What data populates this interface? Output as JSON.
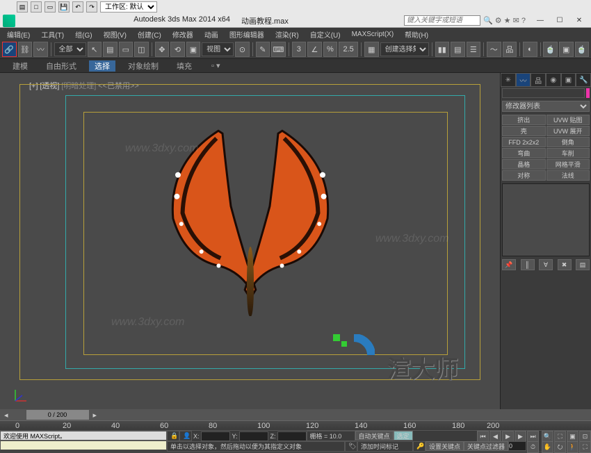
{
  "app": {
    "title": "Autodesk 3ds Max  2014 x64",
    "file": "动画教程.max",
    "search_placeholder": "键入关键字或短语"
  },
  "workspace": {
    "label": "工作区: 默认"
  },
  "menu": [
    "编辑(E)",
    "工具(T)",
    "组(G)",
    "视图(V)",
    "创建(C)",
    "修改器",
    "动画",
    "图形编辑器",
    "渲染(R)",
    "自定义(U)",
    "MAXScript(X)",
    "帮助(H)"
  ],
  "toolbar": {
    "all": "全部",
    "view": "视图",
    "spinner": "2.5",
    "selset": "创建选择集"
  },
  "ribbon": {
    "tabs": [
      "建模",
      "自由形式",
      "选择",
      "对象绘制",
      "填充"
    ],
    "selected": 2
  },
  "viewport": {
    "bracket": "[+]",
    "mode": "[透视]",
    "shade": "[明暗处理]",
    "note": "<<已禁用>>"
  },
  "cmd": {
    "modlist": "修改器列表",
    "buttons": [
      "挤出",
      "UVW 贴图",
      "壳",
      "UVW 展开",
      "FFD 2x2x2",
      "倒角",
      "弯曲",
      "车削",
      "晶格",
      "网格平滑",
      "对称",
      "法线"
    ]
  },
  "timeline": {
    "pos": "0 / 200",
    "ticks": [
      "0",
      "20",
      "40",
      "60",
      "80",
      "100",
      "120",
      "140",
      "160",
      "180",
      "200"
    ]
  },
  "status": {
    "welcome": "欢迎使用 MAXScript。",
    "hint": "单击以选择对象，然后拖动以便为其指定义对象",
    "addmarker": "添加时间标记",
    "x": "X:",
    "y": "Y:",
    "z": "Z:",
    "grid": "栅格 = 10.0",
    "autokey": "自动关键点",
    "selkey": "选定",
    "setkey": "设置关键点",
    "keyfilt": "关键点过滤器"
  }
}
